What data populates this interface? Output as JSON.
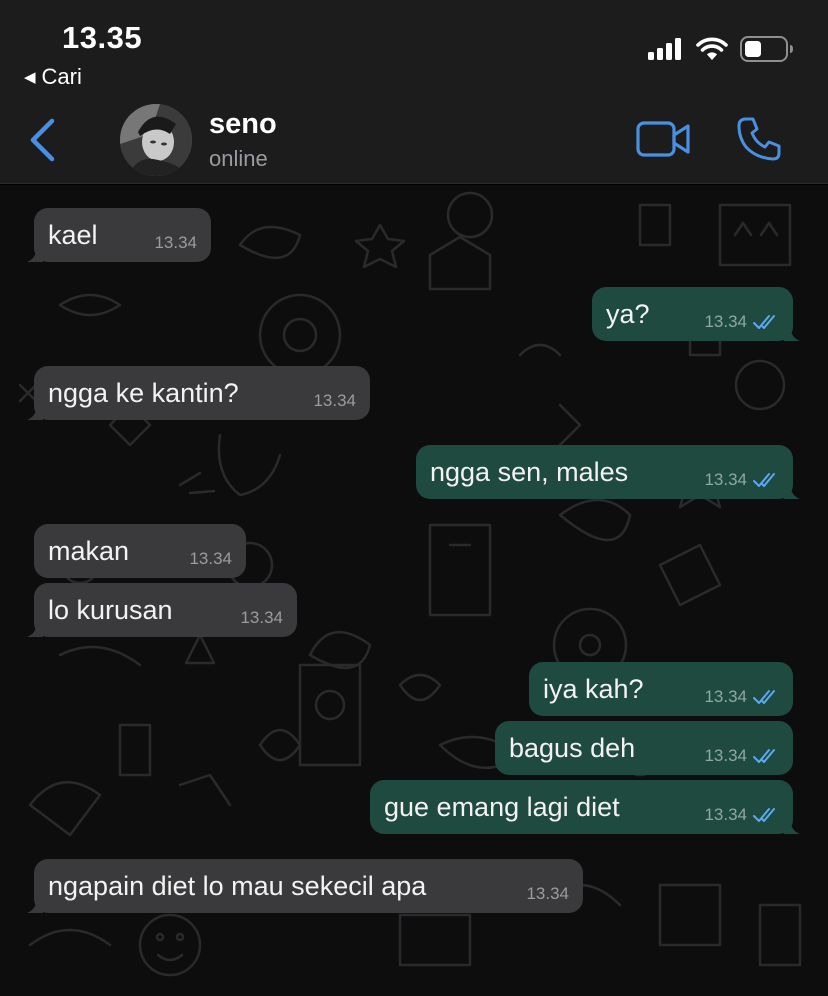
{
  "status_bar": {
    "time": "13.35",
    "back_app_label": "Cari"
  },
  "header": {
    "contact_name": "seno",
    "contact_status": "online"
  },
  "colors": {
    "accent": "#4a90e2",
    "incoming_bubble": "#3a3a3c",
    "outgoing_bubble": "#1f4a3f",
    "read_ticks": "#5aa9f2"
  },
  "messages": [
    {
      "direction": "in",
      "text": "kael",
      "time": "13.34"
    },
    {
      "direction": "out",
      "text": "ya?",
      "time": "13.34",
      "status": "read"
    },
    {
      "direction": "in",
      "text": "ngga ke kantin?",
      "time": "13.34"
    },
    {
      "direction": "out",
      "text": "ngga sen, males",
      "time": "13.34",
      "status": "read"
    },
    {
      "direction": "in",
      "text": "makan",
      "time": "13.34"
    },
    {
      "direction": "in",
      "text": "lo kurusan",
      "time": "13.34"
    },
    {
      "direction": "out",
      "text": "iya kah?",
      "time": "13.34",
      "status": "read"
    },
    {
      "direction": "out",
      "text": "bagus deh",
      "time": "13.34",
      "status": "read"
    },
    {
      "direction": "out",
      "text": "gue emang lagi diet",
      "time": "13.34",
      "status": "read"
    },
    {
      "direction": "in",
      "text": "ngapain diet lo mau sekecil apa",
      "time": "13.34"
    }
  ]
}
